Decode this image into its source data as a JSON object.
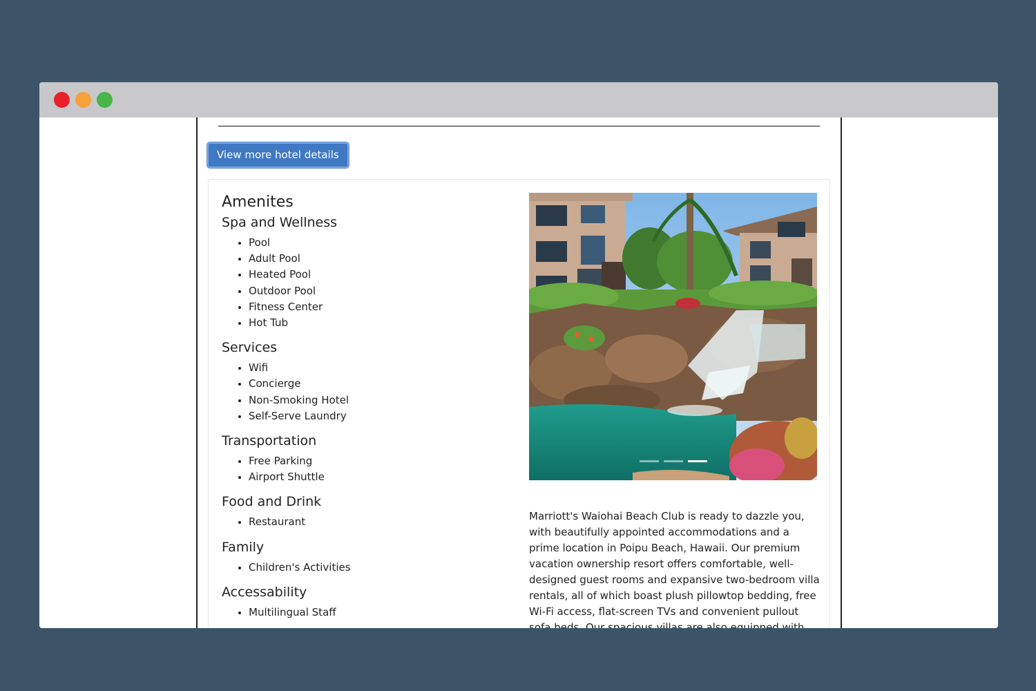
{
  "window": {
    "controls": [
      "close",
      "minimize",
      "maximize"
    ]
  },
  "page": {
    "details_button": "View more hotel details",
    "amenities": {
      "title": "Amenites",
      "groups": [
        {
          "heading": "Spa and Wellness",
          "items": [
            "Pool",
            "Adult Pool",
            "Heated Pool",
            "Outdoor Pool",
            "Fitness Center",
            "Hot Tub"
          ]
        },
        {
          "heading": "Services",
          "items": [
            "Wifi",
            "Concierge",
            "Non-Smoking Hotel",
            "Self-Serve Laundry"
          ]
        },
        {
          "heading": "Transportation",
          "items": [
            "Free Parking",
            "Airport Shuttle"
          ]
        },
        {
          "heading": "Food and Drink",
          "items": [
            "Restaurant"
          ]
        },
        {
          "heading": "Family",
          "items": [
            "Children's Activities"
          ]
        },
        {
          "heading": "Accessability",
          "items": [
            "Multilingual Staff"
          ]
        }
      ]
    },
    "carousel": {
      "image_alt": "Resort waterfall pool with tropical plants and villa buildings",
      "slide_count": 3,
      "active_slide": 3
    },
    "description": "Marriott's Waiohai Beach Club is ready to dazzle you, with beautifully appointed accommodations and a prime location in Poipu Beach, Hawaii. Our premium vacation ownership resort offers comfortable, well-designed guest rooms and expansive two-bedroom villa rentals, all of which boast plush pillowtop bedding, free Wi-Fi access, flat-screen TVs and convenient pullout sofa beds. Our spacious villas are also equipped with full kitchens,"
  }
}
